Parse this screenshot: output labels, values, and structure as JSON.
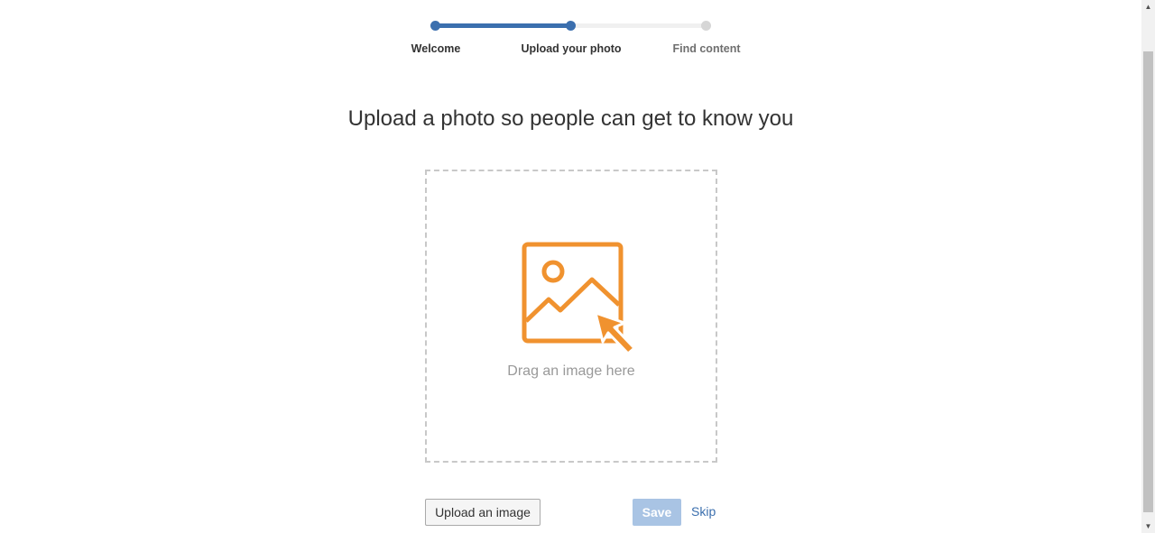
{
  "progress": {
    "steps": [
      {
        "label": "Welcome",
        "state": "complete"
      },
      {
        "label": "Upload your photo",
        "state": "current"
      },
      {
        "label": "Find content",
        "state": "upcoming"
      }
    ],
    "accent_color": "#3b6fae",
    "inactive_color": "#d6d6d6"
  },
  "main": {
    "heading": "Upload a photo so people can get to know you",
    "dropzone": {
      "icon": "image-upload-icon",
      "icon_color": "#f0922f",
      "text": "Drag an image here"
    }
  },
  "actions": {
    "upload_label": "Upload an image",
    "save_label": "Save",
    "save_state": "disabled",
    "skip_label": "Skip"
  }
}
